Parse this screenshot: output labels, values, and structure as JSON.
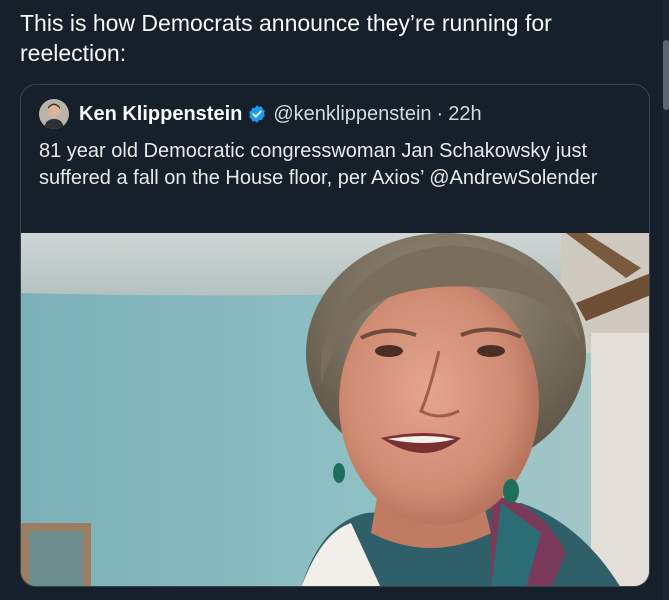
{
  "post": {
    "text": "This is how Democrats announce they’re running for reelection:"
  },
  "quoted_post": {
    "author_name": "Ken Klippenstein",
    "handle": "@kenklippenstein",
    "separator": "·",
    "time": "22h",
    "text": "81 year old Democratic congresswoman Jan Schakowsky just suffered a fall on the House floor, per Axios’ @AndrewSolender",
    "verified_badge_icon": "verified-check-icon",
    "verified_color": "#1d9bf0"
  },
  "colors": {
    "background": "#15202b",
    "card_border": "#38444d",
    "text_primary": "#f7f9f9"
  }
}
